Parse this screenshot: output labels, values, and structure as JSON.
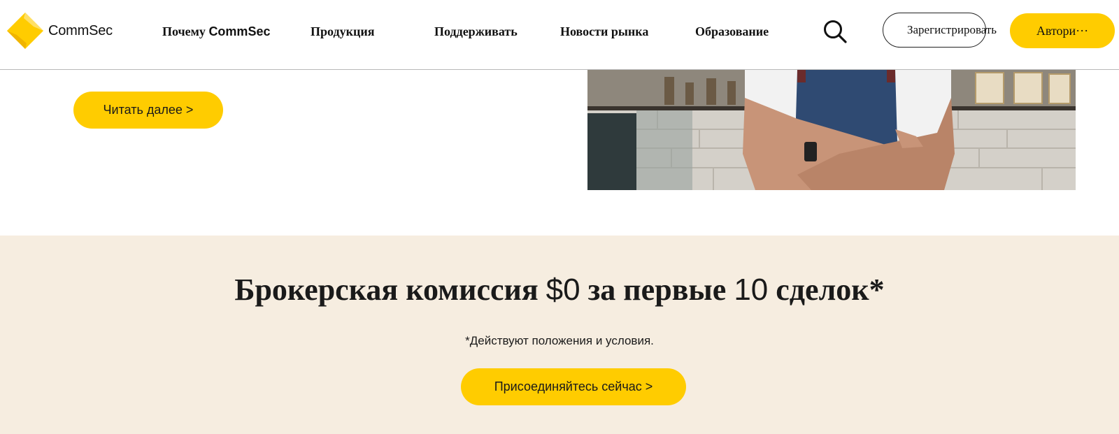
{
  "header": {
    "brand": "CommSec",
    "nav": {
      "why_prefix": "Почему ",
      "why_brand": "CommSec",
      "products": "Продукция",
      "support": "Поддерживать",
      "market_news": "Новости рынка",
      "education": "Образование"
    },
    "register_label": "Зарегистрировать",
    "login_label": "Автори···"
  },
  "feature": {
    "read_more_label": "Читать далее >"
  },
  "promo": {
    "title_part1": "Брокерская комиссия ",
    "title_amount": "$0",
    "title_part2": " за первые ",
    "title_count": "10",
    "title_part3": " сделок*",
    "note": "*Действуют положения и условия.",
    "join_label": "Присоединяйтесь сейчас >"
  },
  "colors": {
    "accent": "#ffcc00",
    "promo_background": "#f6ede0"
  },
  "icons": {
    "logo": "commsec-diamond-logo",
    "search": "search-icon"
  }
}
